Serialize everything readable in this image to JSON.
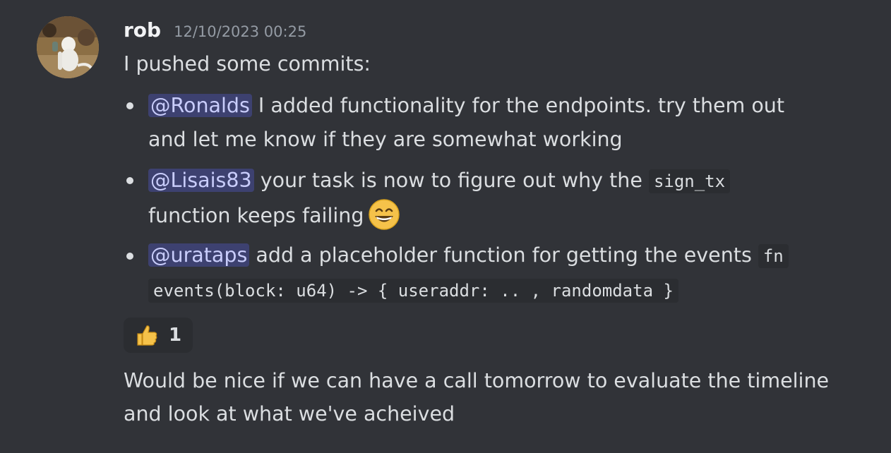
{
  "message": {
    "author": "rob",
    "timestamp": "12/10/2023 00:25",
    "intro": "I pushed some commits:",
    "bullets": [
      {
        "mention": "@Ronalds",
        "text_1": " I added functionality for the endpoints. try them out",
        "text_2": "and let me know if they are somewhat working"
      },
      {
        "mention": "@Lisais83",
        "text_1": " your task is now to figure out why the ",
        "code": "sign_tx",
        "text_2": "function keeps failing",
        "emoji": "grinning-smiling-eyes-emoji"
      },
      {
        "mention": "@urataps",
        "text_1": " add a placeholder function for getting the events ",
        "code_1": "fn",
        "code_2": "events(block: u64) -> { useraddr: .. , randomdata }"
      }
    ],
    "reaction": {
      "emoji": "thumbs-up-emoji",
      "count": "1"
    },
    "followup_1": "Would be nice if we can have a call tomorrow to evaluate the timeline",
    "followup_2": "and look at what we've acheived"
  },
  "colors": {
    "background": "#313338",
    "text": "#dbdee1",
    "mention_bg": "#3c4270",
    "mention_text": "#c9cdfb",
    "timestamp": "#949ba4"
  }
}
